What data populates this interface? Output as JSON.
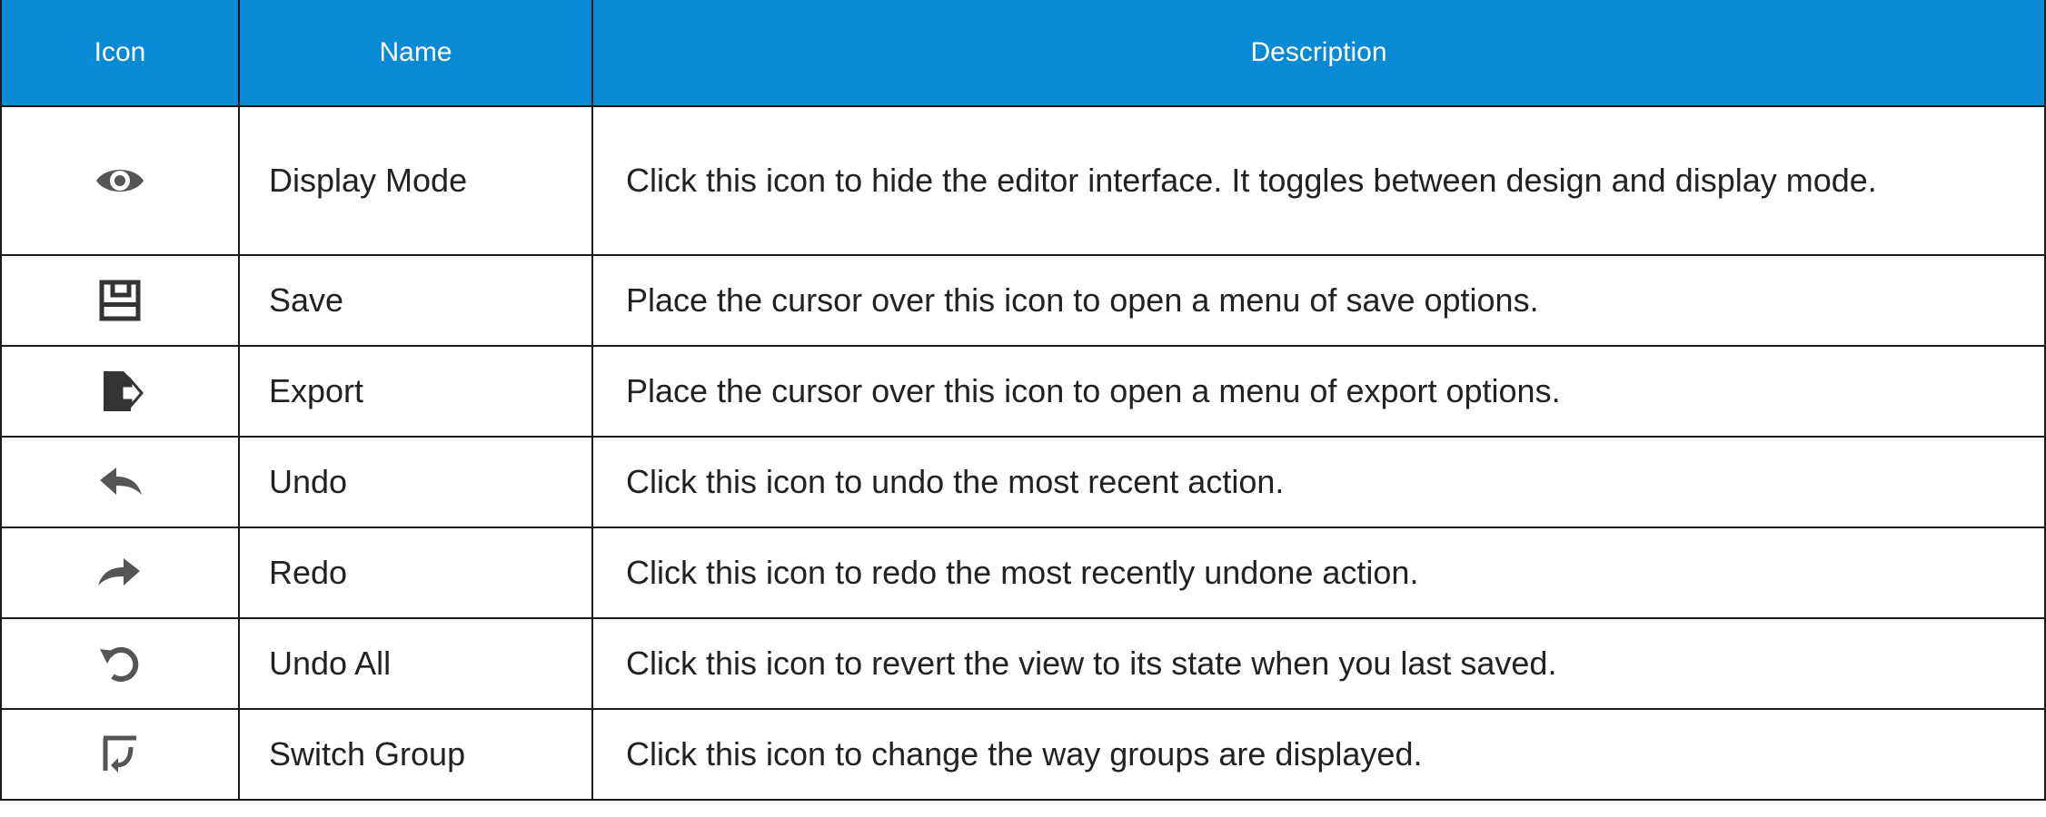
{
  "header": {
    "icon": "Icon",
    "name": "Name",
    "description": "Description"
  },
  "rows": [
    {
      "icon": "eye-icon",
      "name": "Display Mode",
      "description": "Click this icon to hide the editor interface. It toggles between design and display mode."
    },
    {
      "icon": "floppy-disk-icon",
      "name": "Save",
      "description": "Place the cursor over this icon to open a menu of save options."
    },
    {
      "icon": "export-icon",
      "name": "Export",
      "description": "Place the cursor over this icon to open a menu of export options."
    },
    {
      "icon": "undo-arrow-icon",
      "name": "Undo",
      "description": "Click this icon to undo the most recent action."
    },
    {
      "icon": "redo-arrow-icon",
      "name": "Redo",
      "description": "Click this icon to redo the most recently undone action."
    },
    {
      "icon": "undo-all-icon",
      "name": "Undo All",
      "description": "Click this icon to revert the view to its state when you last saved."
    },
    {
      "icon": "switch-group-icon",
      "name": "Switch Group",
      "description": "Click this icon to change the way groups are displayed."
    }
  ],
  "colors": {
    "header_bg": "#0a8ad4",
    "header_text": "#ffffff",
    "border": "#1a1a1a",
    "icon_gray": "#555555"
  }
}
